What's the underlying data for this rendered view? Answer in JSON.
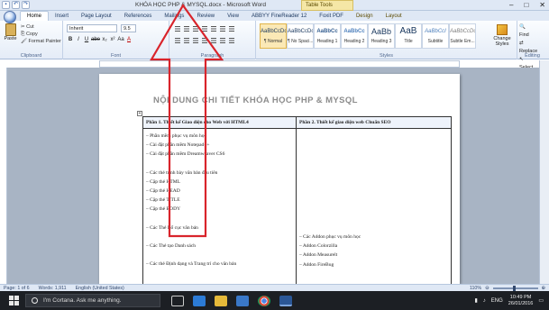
{
  "window": {
    "title": "KHÓA HỌC PHP & MYSQL.docx - Microsoft Word",
    "tools_tab": "Table Tools",
    "controls": [
      "–",
      "□",
      "✕"
    ]
  },
  "tabs": [
    "Home",
    "Insert",
    "Page Layout",
    "References",
    "Mailings",
    "Review",
    "View",
    "ABBYY FineReader 12",
    "Foxit PDF",
    "Design",
    "Layout"
  ],
  "ribbon": {
    "clipboard": {
      "paste": "Paste",
      "cut": "Cut",
      "copy": "Copy",
      "format_painter": "Format Painter",
      "label": "Clipboard"
    },
    "font": {
      "name": "Inherit",
      "size": "9.5",
      "label": "Font",
      "buttons": [
        "B",
        "I",
        "U",
        "abe",
        "x₂",
        "x²",
        "Aa",
        "A"
      ]
    },
    "paragraph": {
      "label": "Paragraph"
    },
    "styles": {
      "label": "Styles",
      "items": [
        {
          "preview": "AaBbCcDc",
          "name": "¶ Normal"
        },
        {
          "preview": "AaBbCcDc",
          "name": "¶ No Spaci..."
        },
        {
          "preview": "AaBbCc",
          "name": "Heading 1"
        },
        {
          "preview": "AaBbCc",
          "name": "Heading 2"
        },
        {
          "preview": "AaBb",
          "name": "Heading 3"
        },
        {
          "preview": "AaB",
          "name": "Title"
        },
        {
          "preview": "AaBbCcI",
          "name": "Subtitle"
        },
        {
          "preview": "AaBbCcDc",
          "name": "Subtle Em..."
        }
      ],
      "change_styles": "Change Styles"
    },
    "editing": {
      "find": "Find",
      "replace": "Replace",
      "select": "Select",
      "label": "Editing"
    }
  },
  "document": {
    "title": "NỘI DUNG CHI TIẾT KHÓA HỌC PHP & MYSQL",
    "table": {
      "headers": [
        "Phần 1. Thiết kế Giao diện cho Web với HTML4",
        "Phần 2. Thiết kế giao diện web Chuẩn SEO"
      ],
      "col1": [
        "– Phần mềm phục vụ môn học",
        "– Cài đặt phần mềm Notepad++",
        "– Cài đặt phần mềm Dreamweaver CS6",
        "",
        "– Các thẻ trình bày văn bản đầu tiên",
        "– Cặp thẻ HTML",
        "– Cặp thẻ HEAD",
        "– Cặp thẻ TITLE",
        "– Cặp thẻ BODY",
        "",
        "– Các Thẻ Bố cục văn bản",
        "",
        "– Các Thẻ tạo Danh sách",
        "",
        "– Các thẻ Định dạng và Trang trí cho văn bản"
      ],
      "col2": [
        "– Các Addon phục vụ môn học",
        "– Addon Colorzilla",
        "– Addon Measurelt",
        "– Addon FireBug"
      ]
    }
  },
  "status": {
    "page": "Page: 1 of 6",
    "words": "Words: 1,911",
    "language": "English (United States)",
    "zoom": "110%"
  },
  "taskbar": {
    "search_placeholder": "I'm Cortana. Ask me anything.",
    "language": "ENG",
    "time": "10:49 PM",
    "date": "26/01/2016"
  },
  "annotation": {
    "arrow_color": "#d9242b"
  }
}
